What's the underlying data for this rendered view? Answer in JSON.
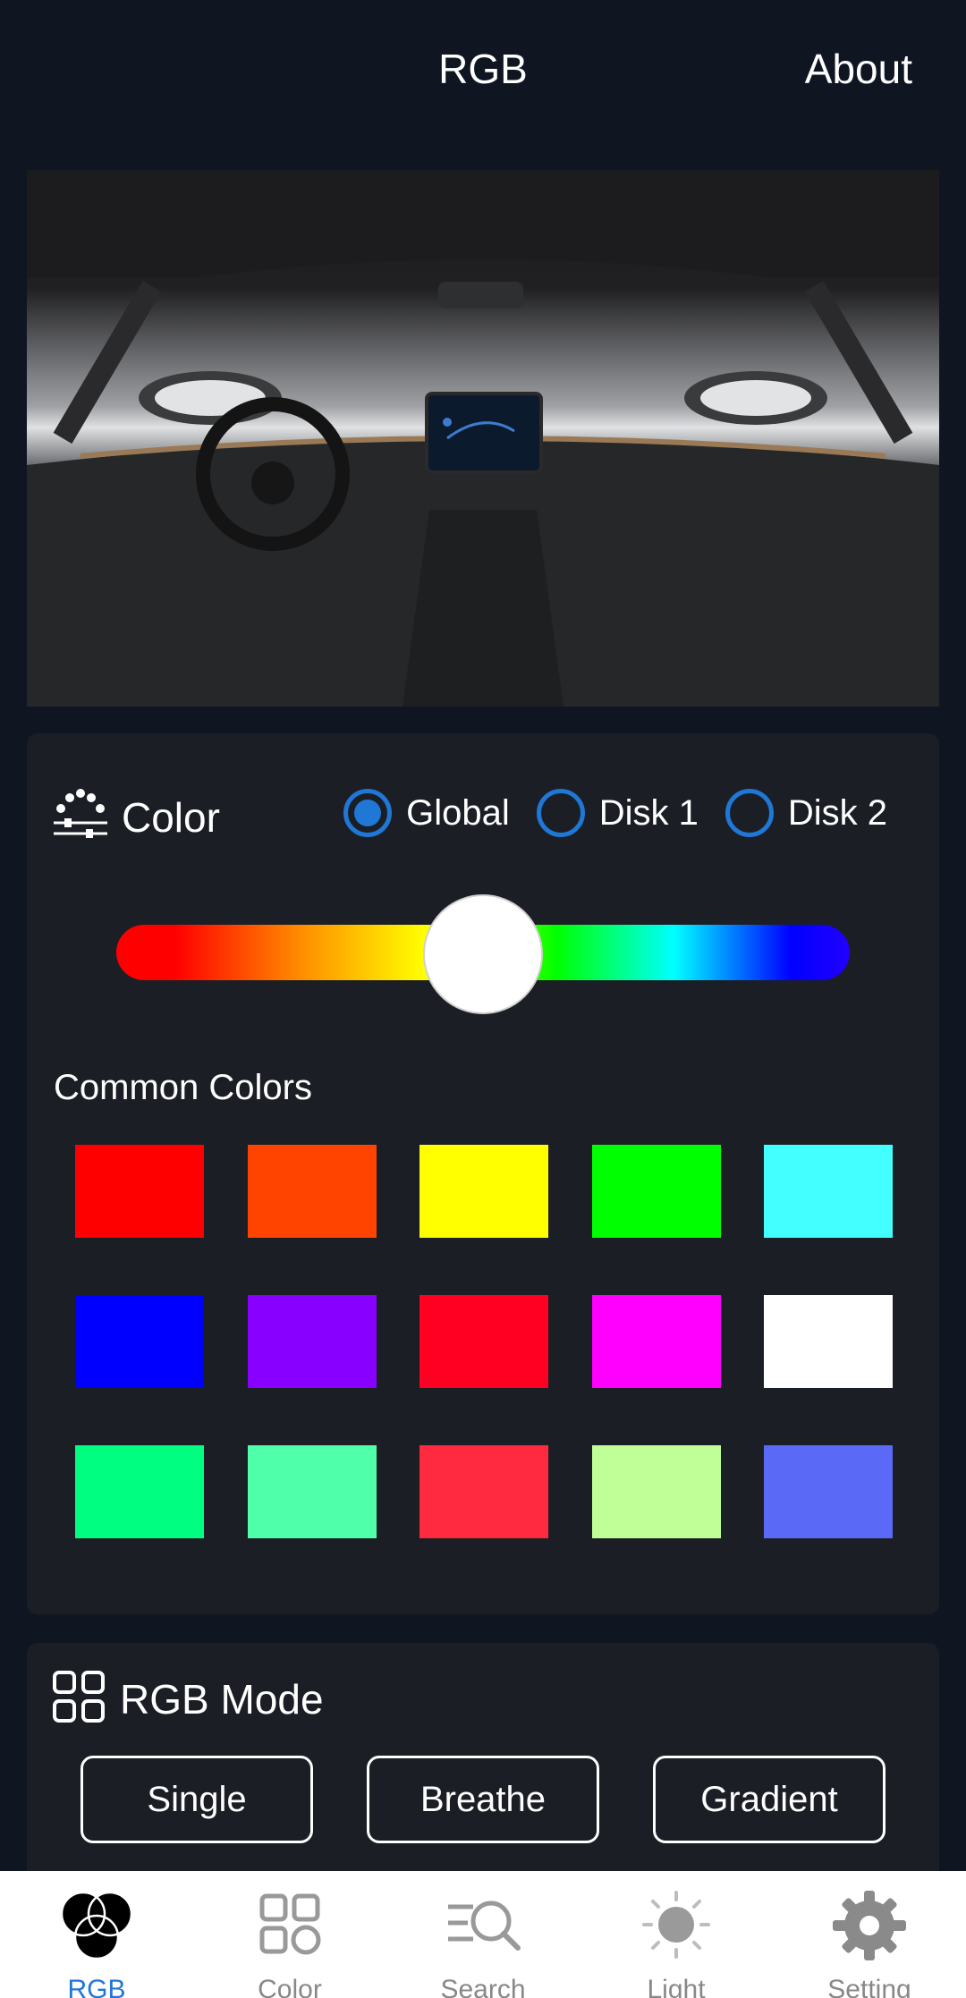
{
  "header": {
    "title": "RGB",
    "about_label": "About"
  },
  "color_section": {
    "title": "Color",
    "radio_options": [
      {
        "label": "Global",
        "selected": true
      },
      {
        "label": "Disk 1",
        "selected": false
      },
      {
        "label": "Disk 2",
        "selected": false
      }
    ],
    "hue_slider_position": 0.5,
    "common_colors_label": "Common Colors",
    "common_colors": [
      [
        "#ff0000",
        "#ff4400",
        "#ffff00",
        "#00ff00",
        "#44ffff"
      ],
      [
        "#0000ff",
        "#8800ff",
        "#ff0022",
        "#ff00ff",
        "#ffffff"
      ],
      [
        "#00ff80",
        "#50ffaa",
        "#ff2a40",
        "#c0ff98",
        "#5a6af7"
      ]
    ]
  },
  "mode_section": {
    "title": "RGB Mode",
    "buttons": [
      "Single",
      "Breathe",
      "Gradient"
    ]
  },
  "bottom_nav": {
    "items": [
      {
        "label": "RGB",
        "icon": "rgb-circles-icon",
        "active": true
      },
      {
        "label": "Color",
        "icon": "grid-icon",
        "active": false
      },
      {
        "label": "Search",
        "icon": "search-icon",
        "active": false
      },
      {
        "label": "Light",
        "icon": "sun-icon",
        "active": false
      },
      {
        "label": "Setting",
        "icon": "gear-icon",
        "active": false
      }
    ]
  },
  "colors": {
    "background": "#0f1622",
    "card": "#1b1e24",
    "accent": "#1f77d6",
    "nav_inactive": "#888888"
  }
}
